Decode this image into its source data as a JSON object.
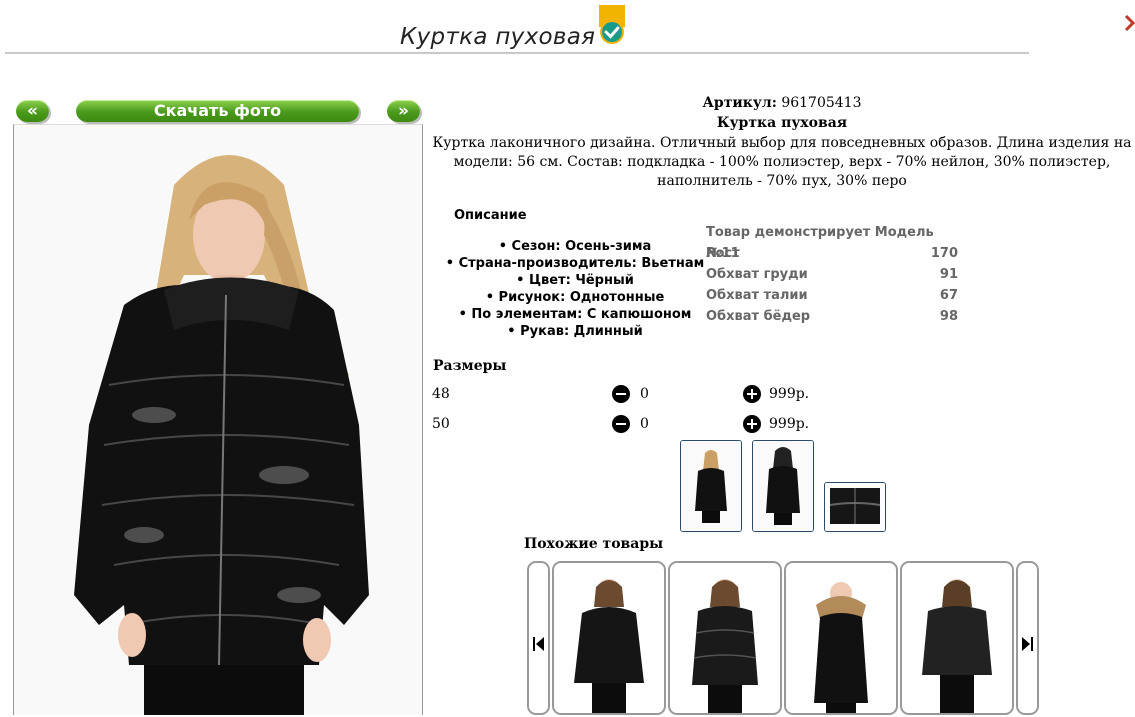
{
  "header": {
    "title": "Куртка пуховая",
    "badge_icon": "check-circle-icon",
    "corner_icon": "close-icon"
  },
  "gallery": {
    "prev_label": "«",
    "download_label": "Скачать фото",
    "next_label": "»",
    "accent_color": "#4a9a1c"
  },
  "product": {
    "article_label": "Артикул:",
    "article_value": "961705413",
    "name": "Куртка пуховая",
    "description": "Куртка лаконичного дизайна. Отличный выбор для повседневных образов. Длина изделия на модели: 56 см. Состав: подкладка - 100% полиэстер, верх - 70% нейлон, 30% полиэстер, наполнитель - 70% пух, 30% перо"
  },
  "details": {
    "heading": "Описание",
    "items": [
      "• Сезон: Осень-зима",
      "• Страна-производитель: Вьетнам",
      "• Цвет: Чёрный",
      "• Рисунок: Однотонные",
      "• По элементам: С капюшоном",
      "• Рукав: Длинный"
    ]
  },
  "model": {
    "heading": "Товар демонстрирует Модель №11",
    "rows": [
      {
        "label": "Рост",
        "value": "170"
      },
      {
        "label": "Обхват груди",
        "value": "91"
      },
      {
        "label": "Обхват талии",
        "value": "67"
      },
      {
        "label": "Обхват бёдер",
        "value": "98"
      }
    ]
  },
  "sizes": {
    "heading": "Размеры",
    "rows": [
      {
        "size": "48",
        "qty": "0",
        "price": "999р."
      },
      {
        "size": "50",
        "qty": "0",
        "price": "999р."
      }
    ]
  },
  "similar": {
    "heading": "Похожие товары"
  }
}
